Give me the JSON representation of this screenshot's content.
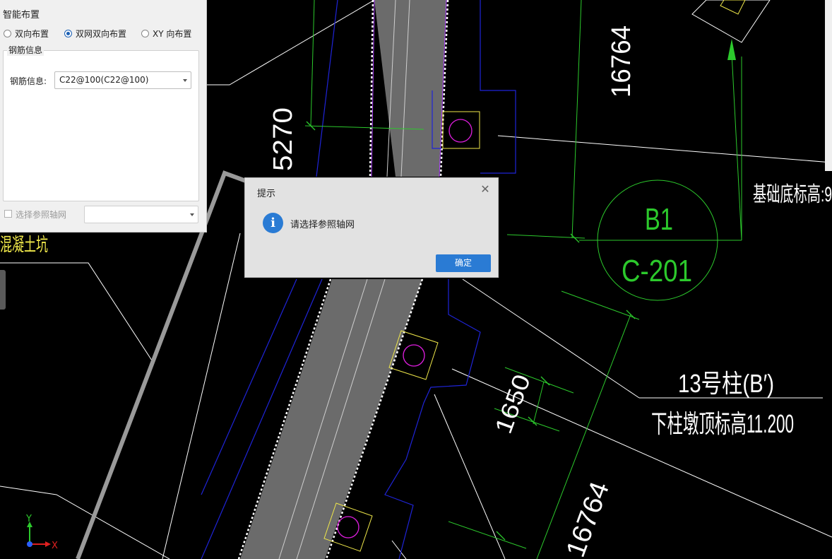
{
  "panel": {
    "title": "智能布置",
    "radios": [
      {
        "label": "双向布置",
        "checked": false
      },
      {
        "label": "双网双向布置",
        "checked": true
      },
      {
        "label": "XY 向布置",
        "checked": false
      }
    ],
    "group_legend": "钢筋信息",
    "rebar_label": "钢筋信息:",
    "rebar_value": "C22@100(C22@100)",
    "axis_checkbox_label": "选择参照轴网",
    "axis_value": ""
  },
  "dialog": {
    "title": "提示",
    "message": "请选择参照轴网",
    "ok_label": "确定"
  },
  "cad": {
    "dim_5270": "5270",
    "dim_16764_top": "16764",
    "dim_16764_bottom": "16764",
    "dim_1650": "1650",
    "base_elev": "基础底标高:9",
    "b1": "B1",
    "c201": "C-201",
    "cap_label": "13号柱(B′)",
    "top_elev": "下柱墩顶标高11.200",
    "concrete_pit": "混凝土坑",
    "axis_x": "X",
    "axis_y": "Y"
  },
  "colors": {
    "white": "#ffffff",
    "blue": "#1f24d8",
    "green": "#2cc92c",
    "magenta": "#e01ee0",
    "yellow": "#f0e84a",
    "gray_fill": "#6b6b6b",
    "accent": "#2a7bd4"
  }
}
